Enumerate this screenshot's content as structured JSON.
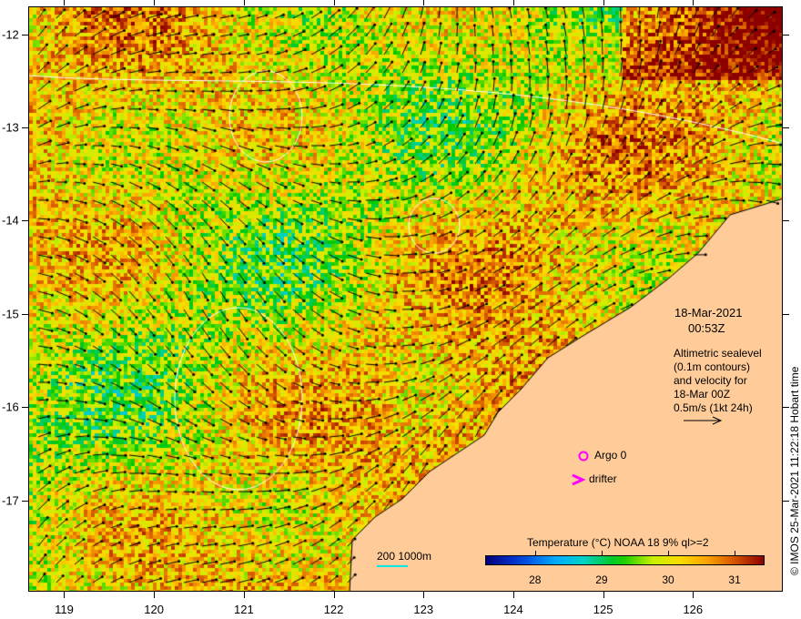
{
  "map": {
    "x_ticks": [
      "119",
      "120",
      "121",
      "122",
      "123",
      "124",
      "125",
      "126"
    ],
    "x_values": [
      119,
      120,
      121,
      122,
      123,
      124,
      125,
      126
    ],
    "y_ticks": [
      "-12",
      "-13",
      "-14",
      "-15",
      "-16",
      "-17"
    ],
    "y_values": [
      -12,
      -13,
      -14,
      -15,
      -16,
      -17
    ],
    "lon_range": [
      118.6,
      127.0
    ],
    "lat_range": [
      -11.7,
      -17.98
    ]
  },
  "annotation": {
    "date": "18-Mar-2021",
    "time": "00:53Z",
    "lines": [
      "Altimetric sealevel",
      "(0.1m contours)",
      "and velocity for",
      "18-Mar 00Z",
      "0.5m/s (1kt 24h)"
    ]
  },
  "legend": {
    "argo": "Argo 0",
    "drifter": "drifter",
    "argo_color": "#ff00ff",
    "scale_label": "200  1000m",
    "scale_color": "#00e5e5"
  },
  "colorbar": {
    "title": "Temperature (°C) NOAA 18 9% ql>=2",
    "ticks": [
      "28",
      "29",
      "30",
      "31"
    ],
    "tick_values": [
      28,
      29,
      30,
      31
    ],
    "range": [
      27.25,
      31.45
    ]
  },
  "stamp": "© IMOS 25-Mar-2021 11:22:18 Hobart time",
  "colors": {
    "land": "#ffcc99",
    "contour": "#ffffff"
  }
}
